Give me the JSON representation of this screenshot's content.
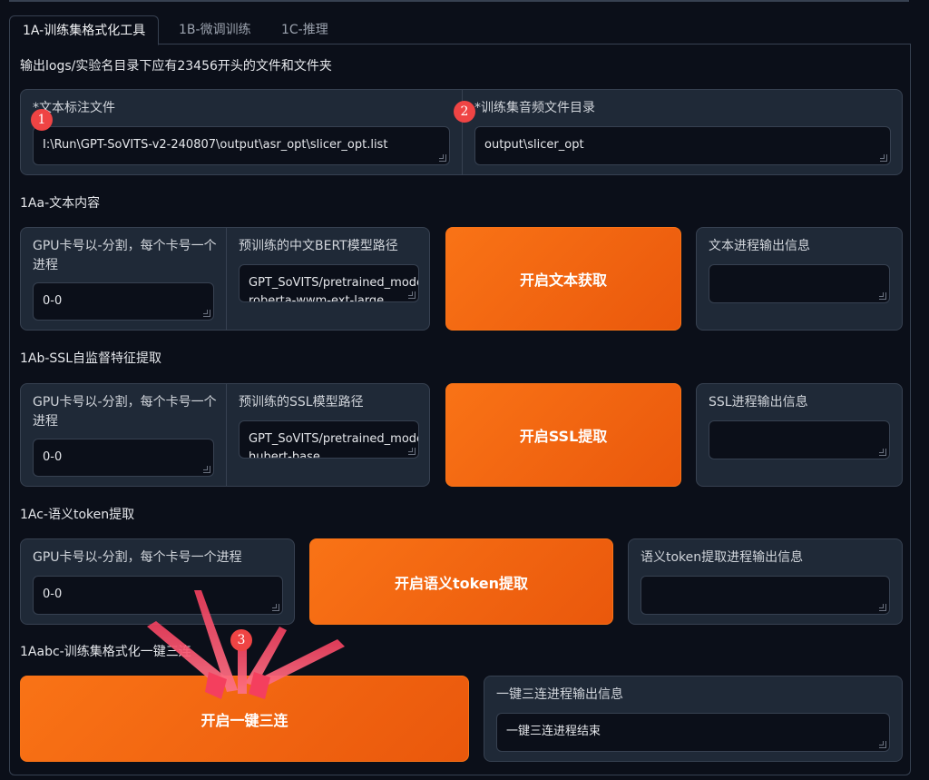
{
  "tabs": [
    {
      "label": "1A-训练集格式化工具",
      "active": true
    },
    {
      "label": "1B-微调训练",
      "active": false
    },
    {
      "label": "1C-推理",
      "active": false
    }
  ],
  "output_note": "输出logs/实验名目录下应有23456开头的文件和文件夹",
  "top_inputs": {
    "text_label": "*文本标注文件",
    "text_value": "I:\\Run\\GPT-SoVITS-v2-240807\\output\\asr_opt\\slicer_opt.list",
    "audio_label": "*训练集音频文件目录",
    "audio_value": "output\\slicer_opt"
  },
  "section_a": {
    "title": "1Aa-文本内容",
    "gpu_label": "GPU卡号以-分割，每个卡号一个进程",
    "gpu_value": "0-0",
    "model_label": "预训练的中文BERT模型路径",
    "model_value": "GPT_SoVITS/pretrained_models/chinese-roberta-wwm-ext-large",
    "button": "开启文本获取",
    "output_label": "文本进程输出信息",
    "output_value": ""
  },
  "section_b": {
    "title": "1Ab-SSL自监督特征提取",
    "gpu_label": "GPU卡号以-分割，每个卡号一个进程",
    "gpu_value": "0-0",
    "model_label": "预训练的SSL模型路径",
    "model_value": "GPT_SoVITS/pretrained_models/chinese-hubert-base",
    "button": "开启SSL提取",
    "output_label": "SSL进程输出信息",
    "output_value": ""
  },
  "section_c": {
    "title": "1Ac-语义token提取",
    "gpu_label": "GPU卡号以-分割，每个卡号一个进程",
    "gpu_value": "0-0",
    "button": "开启语义token提取",
    "output_label": "语义token提取进程输出信息",
    "output_value": ""
  },
  "section_d": {
    "title": "1Aabc-训练集格式化一键三连",
    "button": "开启一键三连",
    "output_label": "一键三连进程输出信息",
    "output_value": "一键三连进程结束"
  },
  "annotations": {
    "badges": [
      "1",
      "2",
      "3"
    ],
    "color": "#ef4444"
  },
  "colors": {
    "accent": "#f97316",
    "background": "#0b0f19",
    "panel": "#1f2937"
  }
}
